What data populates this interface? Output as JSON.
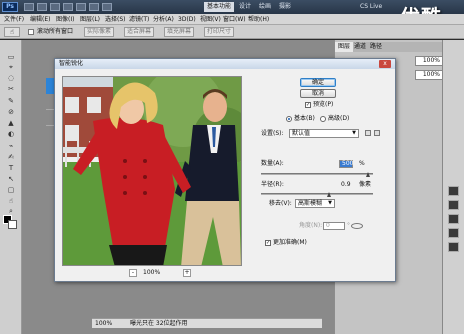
{
  "topbar": {
    "logo": "Ps",
    "workspaces": [
      "基本功能",
      "设计",
      "绘画",
      "摄影"
    ],
    "active_workspace": "基本功能",
    "cs_live": "CS Live",
    "watermark": "优酷"
  },
  "menubar": {
    "items": [
      "文件(F)",
      "编辑(E)",
      "图像(I)",
      "图层(L)",
      "选择(S)",
      "滤镜(T)",
      "分析(A)",
      "3D(D)",
      "视图(V)",
      "窗口(W)",
      "帮助(H)"
    ]
  },
  "options": {
    "scroll_all_label": "滚动所有窗口",
    "buttons": [
      "实际像素",
      "适合屏幕",
      "填充屏幕",
      "打印尺寸"
    ]
  },
  "toolbar": {
    "tools": [
      "▭",
      "⌖",
      "◌",
      "✂",
      "✎",
      "⊘",
      "▲",
      "◐",
      "⌁",
      "✍",
      "T",
      "↖",
      "▢",
      "☝",
      "⌕"
    ]
  },
  "dialog": {
    "title": "智能锐化",
    "close_label": "x",
    "buttons": {
      "ok": "确定",
      "cancel": "取消"
    },
    "preview_label": "预览(P)",
    "modes": {
      "basic": "基本(B)",
      "advanced": "高级(D)"
    },
    "settings_label": "设置(S):",
    "settings_value": "默认值",
    "amount_label": "数量(A):",
    "amount_value": "500",
    "amount_unit": "%",
    "radius_label": "半径(R):",
    "radius_value": "0.9",
    "radius_unit": "像素",
    "remove_label": "移去(V):",
    "remove_value": "高斯模糊",
    "angle_label": "角度(N):",
    "angle_value": "0",
    "angle_unit": "°",
    "more_accurate_label": "更加准确(M)",
    "zoom": {
      "minus": "-",
      "value": "100%",
      "plus": "+"
    }
  },
  "status": {
    "zoom": "100%",
    "text": "曝光只在 32位起作用"
  },
  "right_panel": {
    "tabs": [
      "图层",
      "通道",
      "路径"
    ],
    "opacity_value": "100%",
    "fill_value": "100%"
  },
  "colors": {
    "accent": "#2c84d8",
    "coat_red": "#c81e24",
    "grass_green": "#5e9a3a"
  }
}
